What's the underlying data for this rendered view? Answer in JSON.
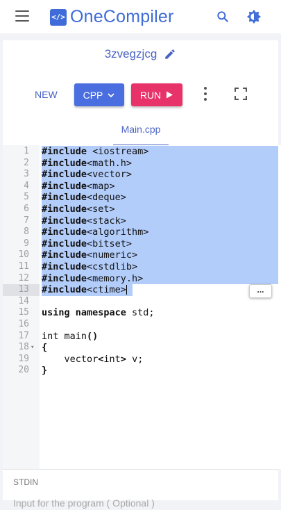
{
  "header": {
    "logo_mark": "</>",
    "logo_text": "OneCompiler"
  },
  "project": {
    "title": "3zvegzjcg"
  },
  "toolbar": {
    "new_label": "NEW",
    "language_label": "CPP",
    "run_label": "RUN"
  },
  "tabs": [
    {
      "label": "Main.cpp",
      "active": true
    }
  ],
  "editor": {
    "lines": [
      {
        "n": "1",
        "parts": [
          [
            "kw",
            "#include"
          ],
          [
            "",
            " <iostream>"
          ]
        ],
        "selected": true
      },
      {
        "n": "2",
        "parts": [
          [
            "kw",
            "#include"
          ],
          [
            "",
            "<math.h>"
          ]
        ],
        "selected": true
      },
      {
        "n": "3",
        "parts": [
          [
            "kw",
            "#include"
          ],
          [
            "",
            "<vector>"
          ]
        ],
        "selected": true
      },
      {
        "n": "4",
        "parts": [
          [
            "kw",
            "#include"
          ],
          [
            "",
            "<map>"
          ]
        ],
        "selected": true
      },
      {
        "n": "5",
        "parts": [
          [
            "kw",
            "#include"
          ],
          [
            "",
            "<deque>"
          ]
        ],
        "selected": true
      },
      {
        "n": "6",
        "parts": [
          [
            "kw",
            "#include"
          ],
          [
            "",
            "<set>"
          ]
        ],
        "selected": true
      },
      {
        "n": "7",
        "parts": [
          [
            "kw",
            "#include"
          ],
          [
            "",
            "<stack>"
          ]
        ],
        "selected": true
      },
      {
        "n": "8",
        "parts": [
          [
            "kw",
            "#include"
          ],
          [
            "",
            "<algorithm>"
          ]
        ],
        "selected": true
      },
      {
        "n": "9",
        "parts": [
          [
            "kw",
            "#include"
          ],
          [
            "",
            "<bitset>"
          ]
        ],
        "selected": true
      },
      {
        "n": "10",
        "parts": [
          [
            "kw",
            "#include"
          ],
          [
            "",
            "<numeric>"
          ]
        ],
        "selected": true
      },
      {
        "n": "11",
        "parts": [
          [
            "kw",
            "#include"
          ],
          [
            "",
            "<cstdlib>"
          ]
        ],
        "selected": true
      },
      {
        "n": "12",
        "parts": [
          [
            "kw",
            "#include"
          ],
          [
            "",
            "<memory.h>"
          ]
        ],
        "selected": true
      },
      {
        "n": "13",
        "parts": [
          [
            "kw",
            "#include"
          ],
          [
            "",
            "<ctime>"
          ]
        ],
        "selected": true,
        "cursor": true
      },
      {
        "n": "14",
        "parts": []
      },
      {
        "n": "15",
        "parts": [
          [
            "kw",
            "using namespace"
          ],
          [
            "",
            " std;"
          ]
        ]
      },
      {
        "n": "16",
        "parts": []
      },
      {
        "n": "17",
        "parts": [
          [
            "",
            "int main"
          ],
          [
            "kw",
            "()"
          ]
        ]
      },
      {
        "n": "18",
        "parts": [
          [
            "kw",
            "{"
          ]
        ],
        "fold": true
      },
      {
        "n": "19",
        "parts": [
          [
            "",
            "    vector"
          ],
          [
            "kw",
            "<"
          ],
          [
            "",
            "int"
          ],
          [
            "kw",
            ">"
          ],
          [
            "",
            " v;"
          ]
        ]
      },
      {
        "n": "20",
        "parts": [
          [
            "kw",
            "}"
          ]
        ]
      }
    ],
    "ellipsis_label": "..."
  },
  "stdin": {
    "label": "STDIN",
    "placeholder": "Input for the program ( Optional )"
  },
  "colors": {
    "brand": "#3f6cd8",
    "run": "#e8336a",
    "selection": "#b3cdfb"
  }
}
